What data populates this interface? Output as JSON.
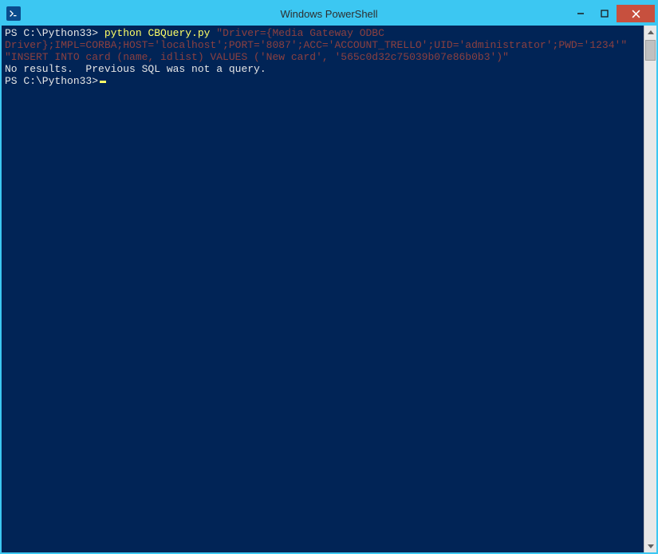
{
  "window": {
    "title": "Windows PowerShell",
    "icon_label": "PS"
  },
  "terminal": {
    "line1_prompt": "PS C:\\Python33>",
    "line1_cmd": " python CBQuery.py ",
    "line1_arg1": "\"Driver={Media Gateway ODBC Driver};IMPL=CORBA;HOST='localhost';PORT='8087';ACC='ACCOUNT_TRELLO';UID='administrator';PWD='1234'\" \"INSERT INTO card (name, idlist) VALUES ('New card', '565c0d32c75039b07e86b0b3')\"",
    "line2_output": "No results.  Previous SQL was not a query.",
    "line3_prompt": "PS C:\\Python33>"
  },
  "colors": {
    "terminal_bg": "#012456",
    "titlebar": "#3cc7f2",
    "close": "#c7503e"
  }
}
